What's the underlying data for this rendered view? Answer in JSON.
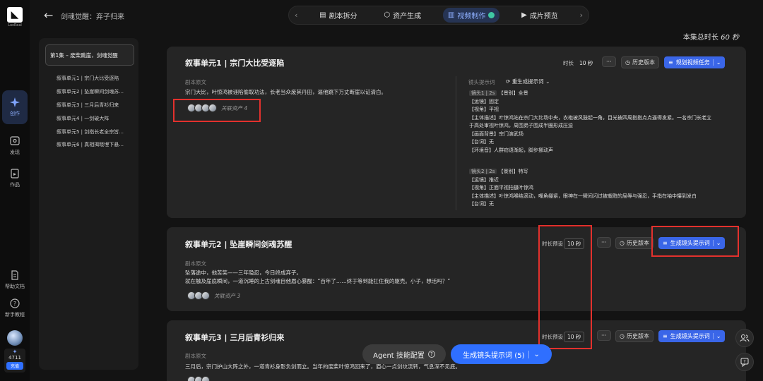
{
  "sidebar": {
    "logo_text": "LuxReal",
    "items": [
      {
        "label": "创作"
      },
      {
        "label": "发现"
      },
      {
        "label": "作品"
      }
    ],
    "help": "帮助文档",
    "tutorial": "新手教程",
    "credits": "4711",
    "recharge": "充值"
  },
  "header": {
    "project": "剑魂觉醒：弃子归来",
    "steps": [
      {
        "label": "剧本拆分"
      },
      {
        "label": "资产生成"
      },
      {
        "label": "视频制作"
      },
      {
        "label": "成片预览"
      }
    ],
    "total_label": "本集总时长",
    "total_value": "60 秒"
  },
  "episodes": {
    "current": "第1集 – 废柴跳崖，剑魂觉醒",
    "units": [
      "叙事单元1 | 宗门大比受逐陷",
      "叙事单元2 | 坠崖瞬间剑魂苏...",
      "叙事单元3 | 三月后青衫归来",
      "叙事单元4 | 一剑破大阵",
      "叙事单元5 | 剑指长老全宗皆...",
      "叙事单元6 | 真相揭晓埋下悬..."
    ]
  },
  "card1": {
    "title": "叙事单元1 |  宗门大比受逐陷",
    "duration_label": "时长",
    "duration_value": "10 秒",
    "more": "···",
    "history": "历史版本",
    "plan_btn": "规划视频任务",
    "script_label": "剧本原文",
    "script_text": "宗门大比，叶惊鸿被诬陷偷取功法，长老当众废其丹田，逼他跳下万丈断崖以证清白。",
    "assets_label": "关联资产 4",
    "prompt_label": "镜头提示词",
    "regen": "重生成提示词",
    "shot1": {
      "tag": "镜头1 | 2s",
      "kind": "【景别】全景",
      "lines": [
        "【运镜】固定",
        "【视角】平视",
        "【主体描述】叶惊鸿站在宗门大比场中央，衣袍被风鼓起一角，目光被四周指指点点逼得发紧。一名宗门长老立",
        "于高处审视叶惊鸿，周围弟子围成半圈形成压迫",
        "【画面背景】宗门演武场",
        "【台词】无",
        "【环境音】人群窃语渐起，脚步挪动声"
      ]
    },
    "shot2": {
      "tag": "镜头2 | 2s",
      "kind": "【景别】特写",
      "lines": [
        "【运镜】推近",
        "【视角】正面平视拍摄叶惊鸿",
        "【主体描述】叶惊鸿喉结滚动，嘴角绷紧，眼神在一瞬间闪过被栽赃的屈辱与强忍，手指在袖中攥到发白",
        "【台词】无"
      ]
    }
  },
  "card2": {
    "title": "叙事单元2 |  坠崖瞬间剑魂苏醒",
    "duration_label": "时长预设",
    "duration_value": "10 秒",
    "more": "···",
    "history": "历史版本",
    "gen_btn": "生成镜头提示词",
    "script_label": "剧本原文",
    "script_line1": "坠落途中，他苦笑——三年隐忍，今日终成弃子。",
    "script_line2": "就在触及崖底瞬间，一道沉睡的上古剑魂自他眉心暴醒：“百年了……终于等到能扛住我的躯壳。小子，想活吗？”",
    "assets_label": "关联资产 3"
  },
  "card3": {
    "title": "叙事单元3 |  三月后青衫归来",
    "duration_label": "时长预设",
    "duration_value": "10 秒",
    "more": "···",
    "history": "历史版本",
    "gen_btn": "生成镜头提示词",
    "script_label": "剧本原文",
    "script_text": "三月后，宗门护山大阵之外，一道青衫身影负剑而立。当年的废柴叶惊鸿回来了，眉心一点剑纹流转，气息深不见底。"
  },
  "bottom": {
    "agent": "Agent 技能配置",
    "generate": "生成镜头提示词 (5)"
  }
}
